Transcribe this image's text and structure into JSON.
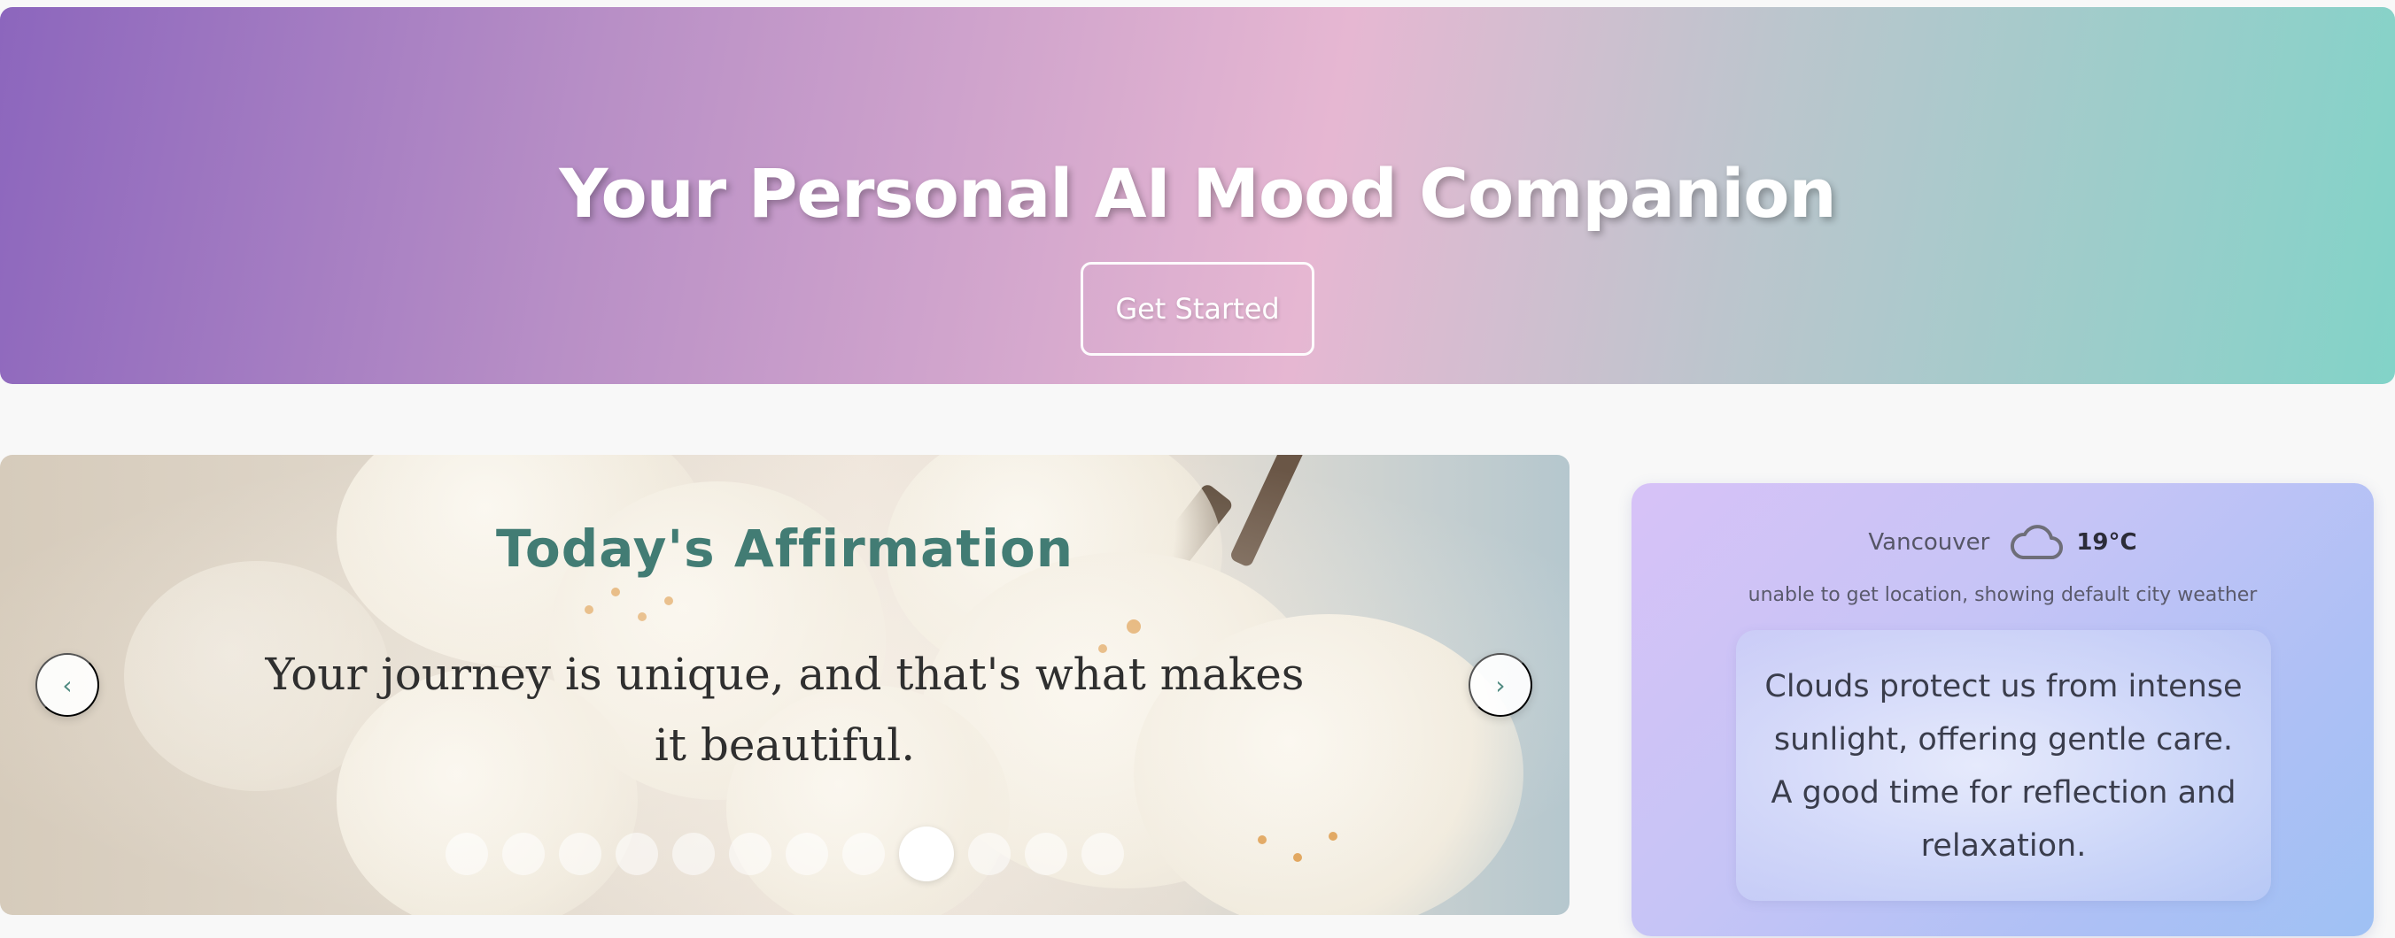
{
  "hero": {
    "title": "Your Personal AI Mood Companion",
    "cta_label": "Get Started"
  },
  "affirmation": {
    "title": "Today's Affirmation",
    "text": "Your journey is unique, and that's what makes it beautiful.",
    "prev_label": "‹",
    "next_label": "›",
    "total_slides": 12,
    "active_slide": 9
  },
  "weather": {
    "city": "Vancouver",
    "icon": "cloud-icon",
    "temperature": "19°C",
    "note": "unable to get location, showing default city weather",
    "message": "Clouds protect us from intense sunlight, offering gentle care. A good time for reflection and relaxation."
  },
  "colors": {
    "accent_teal": "#427c74",
    "hero_gradient_start": "#8c66bd",
    "hero_gradient_mid": "#e6b7d2",
    "hero_gradient_end": "#82d3c8",
    "weather_card_start": "#d7c2f7",
    "weather_card_end": "#9fc1f4"
  }
}
